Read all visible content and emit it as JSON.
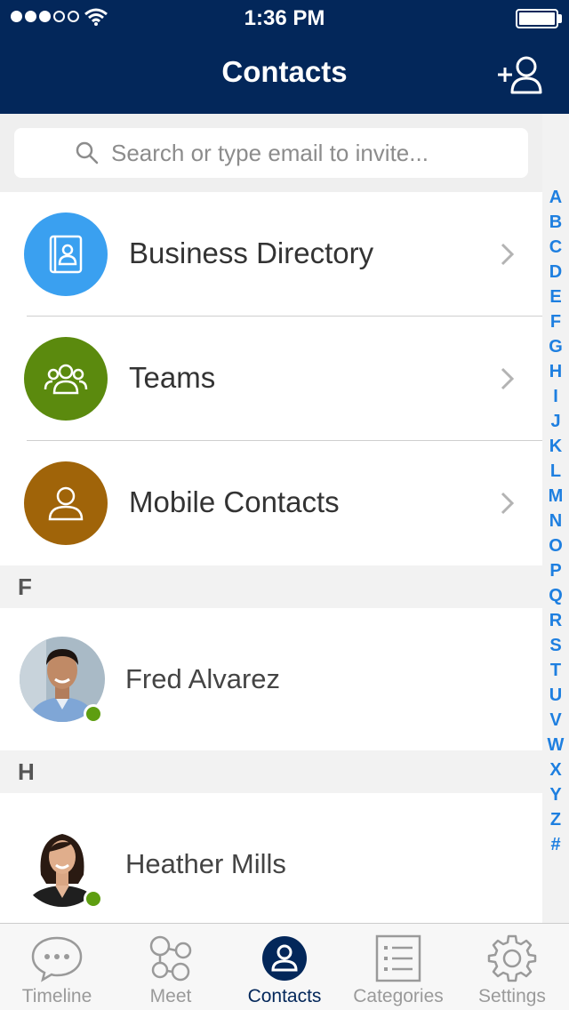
{
  "status_bar": {
    "time": "1:36 PM",
    "signal_dots_filled": 3,
    "signal_dots_total": 5
  },
  "header": {
    "title": "Contacts",
    "add_contact_icon": "add-contact-icon"
  },
  "search": {
    "placeholder": "Search or type email to invite..."
  },
  "directories": [
    {
      "label": "Business Directory",
      "icon": "address-book-icon",
      "color": "#3aa0f0"
    },
    {
      "label": "Teams",
      "icon": "group-icon",
      "color": "#5b8a0e"
    },
    {
      "label": "Mobile Contacts",
      "icon": "person-icon",
      "color": "#a06409"
    }
  ],
  "sections": [
    {
      "letter": "F",
      "contacts": [
        {
          "name": "Fred Alvarez",
          "presence": "online"
        }
      ]
    },
    {
      "letter": "H",
      "contacts": [
        {
          "name": "Heather Mills",
          "presence": "online"
        }
      ]
    }
  ],
  "alpha_index": [
    "A",
    "B",
    "C",
    "D",
    "E",
    "F",
    "G",
    "H",
    "I",
    "J",
    "K",
    "L",
    "M",
    "N",
    "O",
    "P",
    "Q",
    "R",
    "S",
    "T",
    "U",
    "V",
    "W",
    "X",
    "Y",
    "Z",
    "#"
  ],
  "tabbar": {
    "items": [
      {
        "label": "Timeline",
        "icon": "chat-bubble-icon"
      },
      {
        "label": "Meet",
        "icon": "meet-nodes-icon"
      },
      {
        "label": "Contacts",
        "icon": "contact-icon"
      },
      {
        "label": "Categories",
        "icon": "list-icon"
      },
      {
        "label": "Settings",
        "icon": "gear-icon"
      }
    ],
    "active": "Contacts"
  },
  "colors": {
    "header": "#03275a",
    "accent": "#1e7fe0",
    "presence": "#5e9e11"
  }
}
